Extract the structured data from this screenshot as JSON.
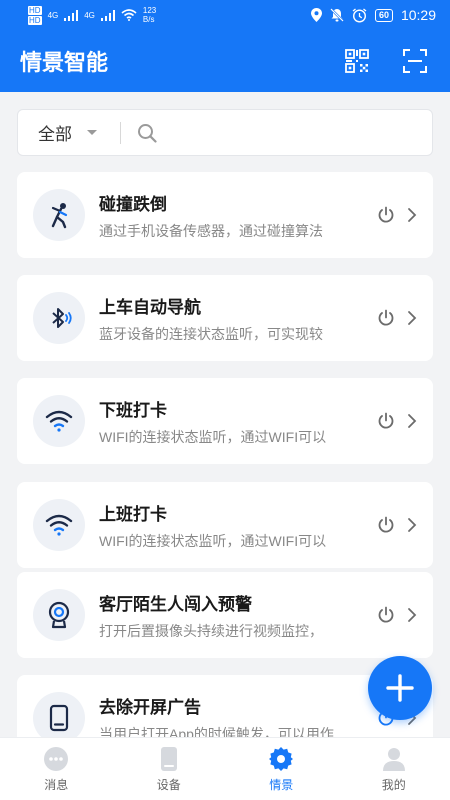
{
  "status_bar": {
    "network_top": "HD",
    "network_bottom": "HD",
    "signal_1": "4G",
    "signal_2": "4G",
    "speed_value": "123",
    "speed_unit": "B/s",
    "battery": "60",
    "time": "10:29"
  },
  "header": {
    "title": "情景智能"
  },
  "search": {
    "filter_label": "全部",
    "placeholder": ""
  },
  "scenes": [
    {
      "title": "碰撞跌倒",
      "desc": "通过手机设备传感器，通过碰撞算法",
      "icon": "fall-person-icon"
    },
    {
      "title": "上车自动导航",
      "desc": "蓝牙设备的连接状态监听，可实现较",
      "icon": "bluetooth-icon"
    },
    {
      "title": "下班打卡",
      "desc": "WIFI的连接状态监听，通过WIFI可以",
      "icon": "wifi-icon"
    },
    {
      "title": "上班打卡",
      "desc": "WIFI的连接状态监听，通过WIFI可以",
      "icon": "wifi-icon"
    },
    {
      "title": "客厅陌生人闯入预警",
      "desc": "打开后置摄像头持续进行视频监控，",
      "icon": "camera-icon"
    },
    {
      "title": "去除开屏广告",
      "desc": "当用户打开App的时候触发，可以用作",
      "icon": "tablet-icon"
    }
  ],
  "nav": [
    {
      "label": "消息",
      "icon": "message-icon"
    },
    {
      "label": "设备",
      "icon": "device-icon"
    },
    {
      "label": "情景",
      "icon": "gear-icon"
    },
    {
      "label": "我的",
      "icon": "user-icon"
    }
  ],
  "colors": {
    "brand": "#1677f7",
    "background": "#f2f3f5",
    "icon_gray": "#6b6b6b"
  }
}
